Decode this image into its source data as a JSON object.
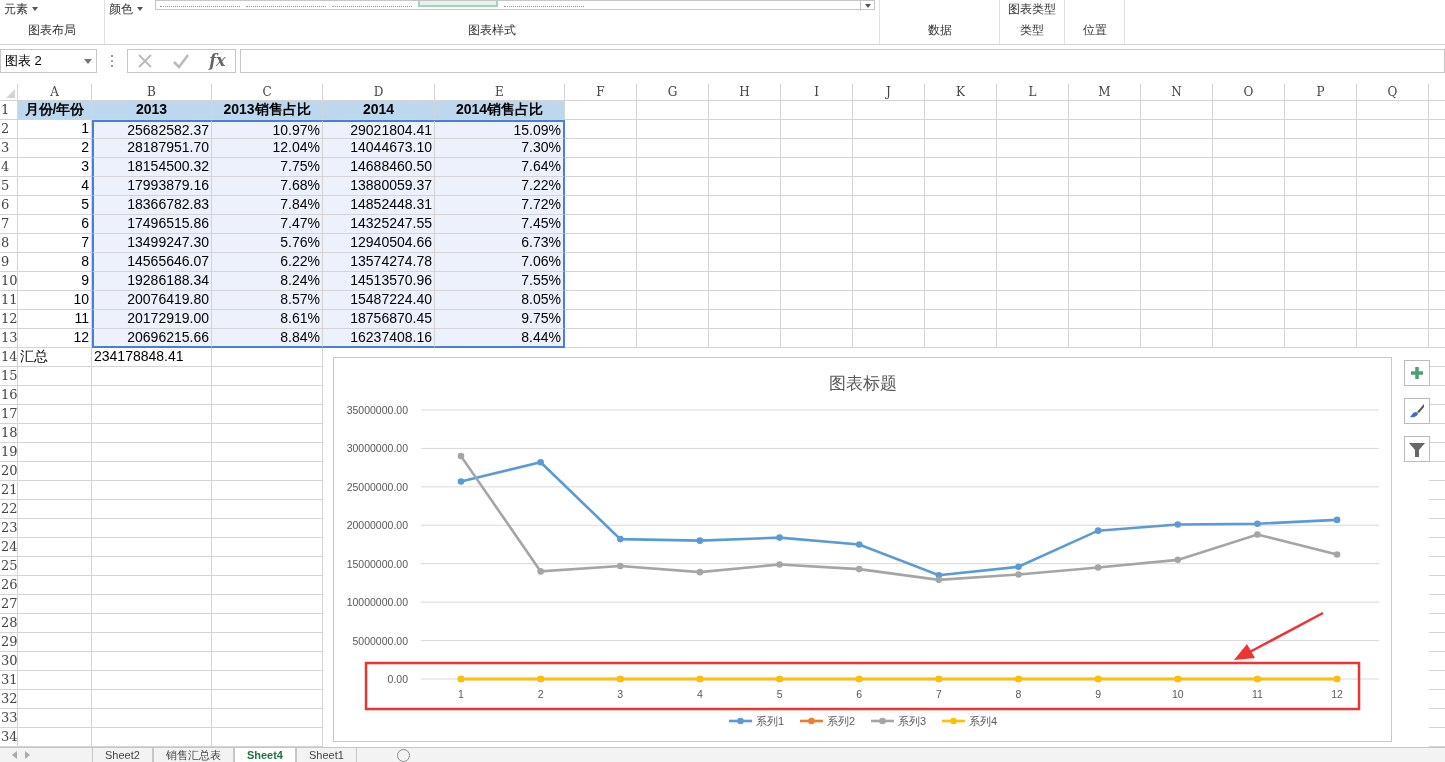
{
  "ribbon": {
    "groups": [
      {
        "label": "图表布局",
        "items": [
          {
            "kind": "dropdown",
            "label": "元素"
          }
        ]
      },
      {
        "label": "图表样式",
        "items": [
          {
            "kind": "dropdown",
            "label": "颜色"
          },
          {
            "kind": "gallery",
            "styles": [
              {
                "selected": false
              },
              {
                "selected": false
              },
              {
                "selected": false
              },
              {
                "selected": true
              },
              {
                "selected": false
              }
            ]
          }
        ]
      },
      {
        "label": "数据"
      },
      {
        "label": "类型",
        "items": [
          {
            "kind": "button",
            "label": "图表类型"
          }
        ]
      },
      {
        "label": "位置"
      }
    ]
  },
  "formula_bar": {
    "name_box": "图表 2",
    "fx": "fx"
  },
  "columns": [
    "A",
    "B",
    "C",
    "D",
    "E",
    "F",
    "G",
    "H",
    "I",
    "J",
    "K",
    "L",
    "M",
    "N",
    "O",
    "P",
    "Q"
  ],
  "rows": [
    {
      "num": "1",
      "kind": "header",
      "selected": false,
      "cells": [
        "月份/年份",
        "2013",
        "2013销售占比",
        "2014",
        "2014销售占比"
      ]
    },
    {
      "num": "2",
      "kind": "data",
      "selected": true,
      "cells": [
        "1",
        "25682582.37",
        "10.97%",
        "29021804.41",
        "15.09%"
      ]
    },
    {
      "num": "3",
      "kind": "data",
      "selected": true,
      "cells": [
        "2",
        "28187951.70",
        "12.04%",
        "14044673.10",
        "7.30%"
      ]
    },
    {
      "num": "4",
      "kind": "data",
      "selected": true,
      "cells": [
        "3",
        "18154500.32",
        "7.75%",
        "14688460.50",
        "7.64%"
      ]
    },
    {
      "num": "5",
      "kind": "data",
      "selected": true,
      "cells": [
        "4",
        "17993879.16",
        "7.68%",
        "13880059.37",
        "7.22%"
      ]
    },
    {
      "num": "6",
      "kind": "data",
      "selected": true,
      "cells": [
        "5",
        "18366782.83",
        "7.84%",
        "14852448.31",
        "7.72%"
      ]
    },
    {
      "num": "7",
      "kind": "data",
      "selected": true,
      "cells": [
        "6",
        "17496515.86",
        "7.47%",
        "14325247.55",
        "7.45%"
      ]
    },
    {
      "num": "8",
      "kind": "data",
      "selected": true,
      "cells": [
        "7",
        "13499247.30",
        "5.76%",
        "12940504.66",
        "6.73%"
      ]
    },
    {
      "num": "9",
      "kind": "data",
      "selected": true,
      "cells": [
        "8",
        "14565646.07",
        "6.22%",
        "13574274.78",
        "7.06%"
      ]
    },
    {
      "num": "10",
      "kind": "data",
      "selected": true,
      "cells": [
        "9",
        "19286188.34",
        "8.24%",
        "14513570.96",
        "7.55%"
      ]
    },
    {
      "num": "11",
      "kind": "data",
      "selected": true,
      "cells": [
        "10",
        "20076419.80",
        "8.57%",
        "15487224.40",
        "8.05%"
      ]
    },
    {
      "num": "12",
      "kind": "data",
      "selected": true,
      "cells": [
        "11",
        "20172919.00",
        "8.61%",
        "18756870.45",
        "9.75%"
      ]
    },
    {
      "num": "13",
      "kind": "data",
      "selected": true,
      "cells": [
        "12",
        "20696215.66",
        "8.84%",
        "16237408.16",
        "8.44%"
      ]
    },
    {
      "num": "14",
      "kind": "total",
      "selected": false,
      "cells": [
        "汇总",
        "234178848.41"
      ]
    },
    {
      "num": "15"
    },
    {
      "num": "16"
    },
    {
      "num": "17"
    },
    {
      "num": "18"
    },
    {
      "num": "19"
    },
    {
      "num": "20"
    },
    {
      "num": "21"
    },
    {
      "num": "22"
    },
    {
      "num": "23"
    },
    {
      "num": "24"
    },
    {
      "num": "25"
    },
    {
      "num": "26"
    },
    {
      "num": "27"
    },
    {
      "num": "28"
    },
    {
      "num": "29"
    },
    {
      "num": "30"
    },
    {
      "num": "31"
    },
    {
      "num": "32"
    },
    {
      "num": "33"
    },
    {
      "num": "34"
    }
  ],
  "chart": {
    "chart_data": {
      "type": "line",
      "title": "图表标题",
      "categories": [
        "1",
        "2",
        "3",
        "4",
        "5",
        "6",
        "7",
        "8",
        "9",
        "10",
        "11",
        "12"
      ],
      "ylim": [
        0,
        35000000
      ],
      "grid": true,
      "legend": true,
      "yticks": [
        {
          "value": 0,
          "label": "0.00"
        },
        {
          "value": 5000000,
          "label": "5000000.00"
        },
        {
          "value": 10000000,
          "label": "10000000.00"
        },
        {
          "value": 15000000,
          "label": "15000000.00"
        },
        {
          "value": 20000000,
          "label": "20000000.00"
        },
        {
          "value": 25000000,
          "label": "25000000.00"
        },
        {
          "value": 30000000,
          "label": "30000000.00"
        },
        {
          "value": 35000000,
          "label": "35000000.00"
        }
      ],
      "series": [
        {
          "name": "系列1",
          "color": "#5b9bd5",
          "marker": true,
          "values": [
            25700000,
            28200000,
            18200000,
            18000000,
            18400000,
            17500000,
            13500000,
            14600000,
            19300000,
            20100000,
            20200000,
            20700000
          ]
        },
        {
          "name": "系列2",
          "color": "#ed7d31",
          "marker": true,
          "values": [
            0,
            0,
            0,
            0,
            0,
            0,
            0,
            0,
            0,
            0,
            0,
            0
          ]
        },
        {
          "name": "系列3",
          "color": "#a5a5a5",
          "marker": true,
          "values": [
            29000000,
            14000000,
            14700000,
            13900000,
            14900000,
            14300000,
            12900000,
            13600000,
            14500000,
            15500000,
            18800000,
            16200000
          ]
        },
        {
          "name": "系列4",
          "color": "#ffc000",
          "marker": true,
          "values": [
            0,
            0,
            0,
            0,
            0,
            0,
            0,
            0,
            0,
            0,
            0,
            0
          ]
        }
      ]
    }
  },
  "sheet_tabs": [
    {
      "label": "Sheet2",
      "selected": false
    },
    {
      "label": "销售汇总表",
      "selected": false
    },
    {
      "label": "Sheet4",
      "selected": true
    },
    {
      "label": "Sheet1",
      "selected": false
    }
  ]
}
